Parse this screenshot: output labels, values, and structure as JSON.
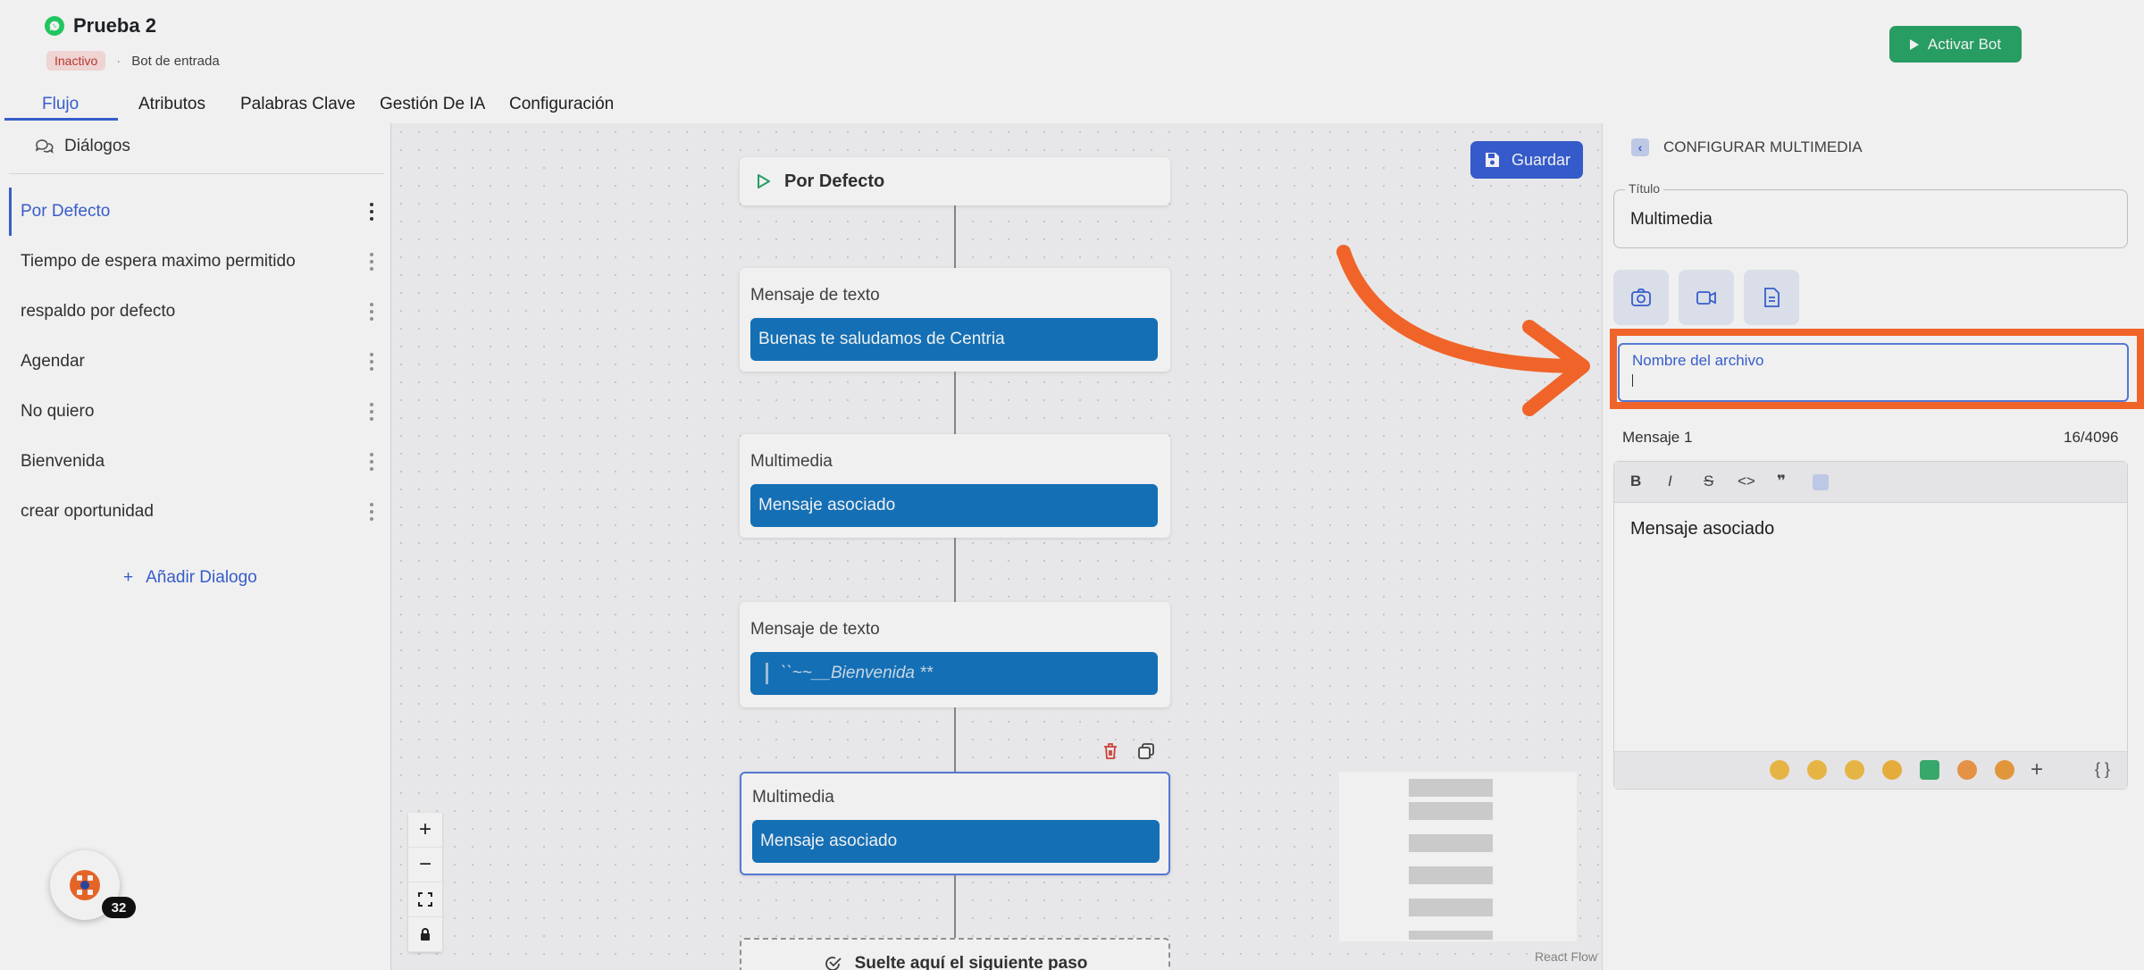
{
  "header": {
    "bot_name": "Prueba 2",
    "status": "Inactivo",
    "bot_type": "Bot de entrada",
    "activate_label": "Activar Bot",
    "colors": {
      "accent": "#3b63d8",
      "activate": "#2aa66a",
      "inactive_bg": "#fde2e1",
      "inactive_text": "#c63b34"
    }
  },
  "tabs": [
    {
      "label": "Flujo",
      "active": true
    },
    {
      "label": "Atributos"
    },
    {
      "label": "Palabras Clave"
    },
    {
      "label": "Gestión De IA"
    },
    {
      "label": "Configuración"
    }
  ],
  "sidebar": {
    "title": "Diálogos",
    "items": [
      {
        "label": "Por Defecto",
        "active": true
      },
      {
        "label": "Tiempo de espera maximo permitido"
      },
      {
        "label": "respaldo por defecto"
      },
      {
        "label": "Agendar"
      },
      {
        "label": "No quiero"
      },
      {
        "label": "Bienvenida"
      },
      {
        "label": "crear oportunidad"
      }
    ],
    "add_label": "Añadir Dialogo"
  },
  "canvas": {
    "save_label": "Guardar",
    "start_node": "Por Defecto",
    "nodes": [
      {
        "title": "Mensaje de texto",
        "message": "Buenas te saludamos de Centria"
      },
      {
        "title": "Multimedia",
        "message": "Mensaje asociado"
      },
      {
        "title": "Mensaje de texto",
        "message": "``~~__Bienvenida **"
      },
      {
        "title": "Multimedia",
        "message": "Mensaje asociado",
        "selected": true
      }
    ],
    "drop_label": "Suelte aquí el siguiente paso",
    "react_flow_label": "React Flow",
    "badge_count": "32"
  },
  "panel": {
    "title": "CONFIGURAR MULTIMEDIA",
    "title_field_label": "Título",
    "title_field_value": "Multimedia",
    "filename_label": "Nombre del archivo",
    "message_label": "Mensaje 1",
    "message_count": "16/4096",
    "message_text": "Mensaje asociado",
    "highlight_color": "#ff6b2c"
  }
}
